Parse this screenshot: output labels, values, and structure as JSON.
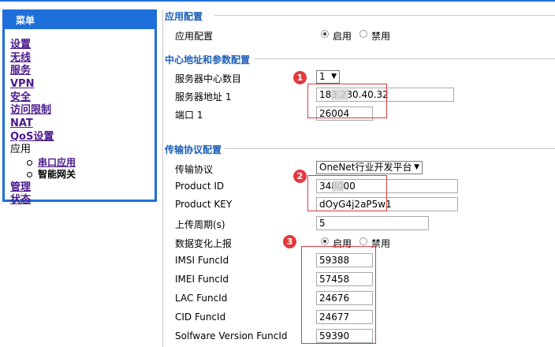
{
  "menu": {
    "title": "菜单",
    "items": [
      {
        "label": "设置"
      },
      {
        "label": "无线"
      },
      {
        "label": "服务"
      },
      {
        "label": "VPN"
      },
      {
        "label": "安全"
      },
      {
        "label": "访问限制"
      },
      {
        "label": "NAT"
      },
      {
        "label": "QoS设置"
      },
      {
        "label": "应用"
      },
      {
        "label": "串口应用"
      },
      {
        "label": "智能网关"
      },
      {
        "label": "管理"
      },
      {
        "label": "状态"
      }
    ]
  },
  "app_config": {
    "section_title": "应用配置",
    "label": "应用配置",
    "enable": "启用",
    "disable": "禁用"
  },
  "center": {
    "section_title": "中心地址和参数配置",
    "count_label": "服务器中心数目",
    "count_value": "1",
    "server_label": "服务器地址 1",
    "server_value": "183.230.40.32",
    "port_label": "端口 1",
    "port_value": "26004"
  },
  "transport": {
    "section_title": "传输协议配置",
    "protocol_label": "传输协议",
    "protocol_value": "OneNet行业开发平台",
    "product_id_label": "Product ID",
    "product_id_value": "348000",
    "product_key_label": "Product KEY",
    "product_key_value": "dOyG4j2aP5w1",
    "period_label": "上传周期(s)",
    "period_value": "5",
    "change_label": "数据变化上报",
    "enable": "启用",
    "disable": "禁用",
    "imsi_label": "IMSI FuncId",
    "imsi_value": "59388",
    "imei_label": "IMEI FuncId",
    "imei_value": "57458",
    "lac_label": "LAC FuncId",
    "lac_value": "24676",
    "cid_label": "CID FuncId",
    "cid_value": "24677",
    "sw_label": "Solfware Version FuncId",
    "sw_value": "59390"
  },
  "badges": [
    "1",
    "2",
    "3"
  ],
  "colors": {
    "accent": "#1e6fd9",
    "annotation": "#e23a3f",
    "link": "#4a1a8c"
  }
}
